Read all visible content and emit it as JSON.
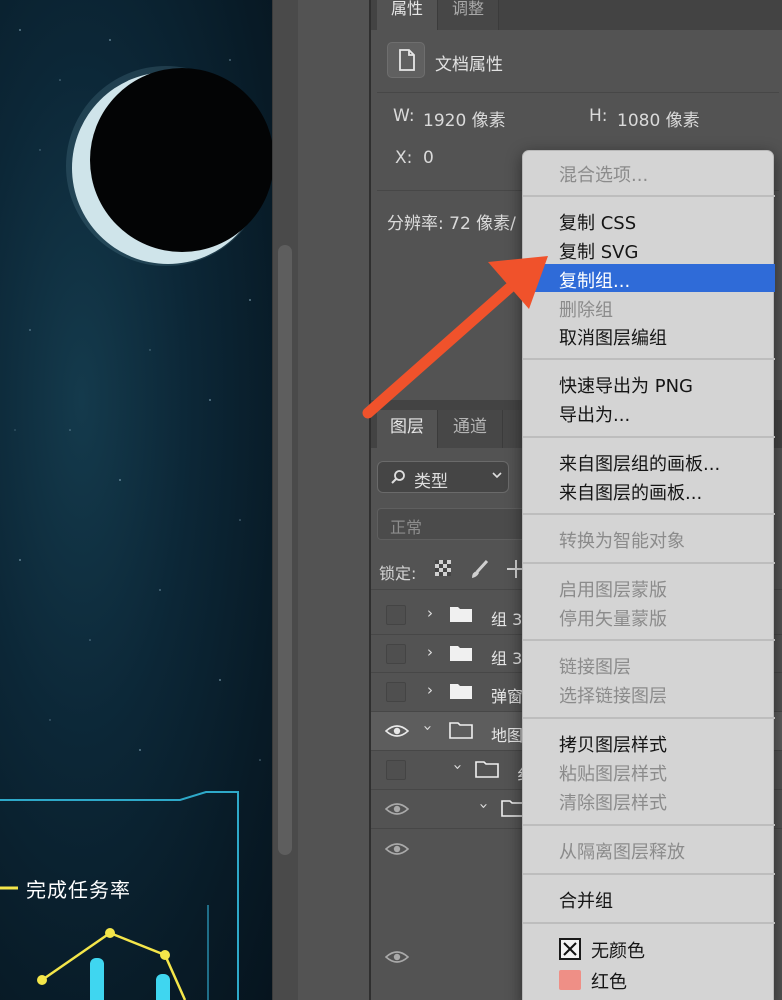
{
  "canvas": {
    "widget_title": "完成任务率"
  },
  "properties_panel": {
    "tabs": [
      "属性",
      "调整"
    ],
    "header": "文档属性",
    "width_label": "W:",
    "width_value": "1920 像素",
    "height_label": "H:",
    "height_value": "1080 像素",
    "x_label": "X:",
    "x_value": "0",
    "resolution": "分辨率: 72 像素/"
  },
  "layers_panel": {
    "tabs": [
      "图层",
      "通道"
    ],
    "filter_label": "类型",
    "blend_mode": "正常",
    "lock_label": "锁定:",
    "rows": [
      {
        "name": "组 3",
        "visible": false,
        "indent": 0
      },
      {
        "name": "组 3",
        "visible": false,
        "indent": 0
      },
      {
        "name": "弹窗",
        "visible": false,
        "indent": 0
      },
      {
        "name": "地图",
        "visible": true,
        "indent": 0,
        "expanded": true,
        "selected": true
      },
      {
        "name": "纟",
        "visible": false,
        "indent": 1,
        "expanded": true
      },
      {
        "name": "",
        "visible": true,
        "indent": 2,
        "expanded": true
      },
      {
        "name": "",
        "visible": true,
        "indent": 0
      },
      {
        "name": "",
        "visible": true,
        "indent": 0
      }
    ]
  },
  "context_menu": {
    "items": [
      {
        "label": "混合选项...",
        "enabled": false
      },
      {
        "label": "复制 CSS",
        "enabled": true
      },
      {
        "label": "复制 SVG",
        "enabled": true
      },
      {
        "label": "复制组...",
        "enabled": true,
        "highlighted": true
      },
      {
        "label": "删除组",
        "enabled": false
      },
      {
        "label": "取消图层编组",
        "enabled": true
      },
      {
        "label": "快速导出为 PNG",
        "enabled": true
      },
      {
        "label": "导出为...",
        "enabled": true
      },
      {
        "label": "来自图层组的画板...",
        "enabled": true
      },
      {
        "label": "来自图层的画板...",
        "enabled": true
      },
      {
        "label": "转换为智能对象",
        "enabled": false
      },
      {
        "label": "启用图层蒙版",
        "enabled": false
      },
      {
        "label": "停用矢量蒙版",
        "enabled": false
      },
      {
        "label": "链接图层",
        "enabled": false
      },
      {
        "label": "选择链接图层",
        "enabled": false
      },
      {
        "label": "拷贝图层样式",
        "enabled": true
      },
      {
        "label": "粘贴图层样式",
        "enabled": false
      },
      {
        "label": "清除图层样式",
        "enabled": false
      },
      {
        "label": "从隔离图层释放",
        "enabled": false
      },
      {
        "label": "合并组",
        "enabled": true
      },
      {
        "label": "无颜色",
        "enabled": true,
        "swatch": "none"
      },
      {
        "label": "红色",
        "enabled": true,
        "swatch": "#ef8f86"
      }
    ]
  },
  "colors": {
    "highlight": "#2f6bd8",
    "arrow": "#f0522b",
    "panel_bg": "#535353",
    "menu_bg": "#d4d4d4",
    "chart_line": "#f4e64a",
    "chart_bar": "#3fd6f0"
  },
  "icons": {
    "doc": "document-icon",
    "search": "search-icon",
    "folder": "folder-icon",
    "eye": "eye-icon",
    "lock_pixels": "checkerboard-lock-icon",
    "lock_brush": "brush-lock-icon",
    "lock_move": "move-lock-icon"
  }
}
